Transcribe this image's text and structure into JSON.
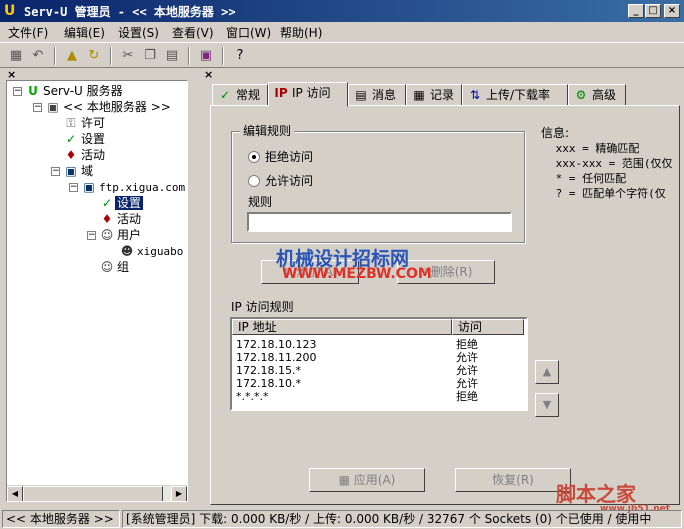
{
  "window": {
    "title": "Serv-U 管理员 - << 本地服务器 >>",
    "app_icon": "serv-u-icon",
    "controls": {
      "minimize": "_",
      "maximize": "□",
      "close": "×"
    }
  },
  "menu": {
    "file": "文件(F)",
    "edit": "编辑(E)",
    "settings": "设置(S)",
    "view": "查看(V)",
    "window": "窗口(W)",
    "help": "帮助(H)"
  },
  "toolbar": {
    "icons": [
      "save-icon",
      "undo-icon",
      "folder-up-icon",
      "refresh-icon",
      "cut-icon",
      "copy-icon",
      "paste-icon",
      "book-icon",
      "help-icon"
    ]
  },
  "tree": {
    "root": "Serv-U 服务器",
    "local_server": "<< 本地服务器 >>",
    "license": "许可",
    "settings": "设置",
    "activity": "活动",
    "domains": "域",
    "domain": "ftp.xigua.com",
    "domain_settings": "设置",
    "domain_activity": "活动",
    "users": "用户",
    "user_xiguabo": "xiguabo",
    "groups": "组"
  },
  "tabs": {
    "general": "常规",
    "ip_access": "IP 访问",
    "messages": "消息",
    "logging": "记录",
    "ul_dl_ratio": "上传/下载率",
    "advanced": "高级",
    "active": "ip_access"
  },
  "edit_rule": {
    "legend": "编辑规则",
    "deny": "拒绝访问",
    "allow": "允许访问",
    "selected": "deny",
    "rule_label": "规则",
    "rule_value": ""
  },
  "info": {
    "title": "信息:",
    "lines": [
      " xxx = 精确匹配",
      " xxx-xxx = 范围(仅仅",
      " * = 任何匹配",
      " ? = 匹配单个字符(仅"
    ]
  },
  "buttons": {
    "add": "添加(A)",
    "delete": "删除(R)",
    "apply": "应用(A)",
    "restore": "恢复(R)"
  },
  "ip_rules": {
    "title": "IP 访问规则",
    "columns": [
      "IP 地址",
      "访问"
    ],
    "rows": [
      [
        "172.18.10.123",
        "拒绝"
      ],
      [
        "172.18.11.200",
        "允许"
      ],
      [
        "172.18.15.*",
        "允许"
      ],
      [
        "172.18.10.*",
        "允许"
      ],
      [
        "*.*.*.*",
        "拒绝"
      ]
    ]
  },
  "status": {
    "server": "<< 本地服务器 >>",
    "stats": "[系统管理员] 下载: 0.000 KB/秒 / 上传: 0.000 KB/秒 / 32767 个 Sockets (0) 个已使用 / 使用中"
  },
  "watermarks": {
    "top": "机械设计招标网",
    "url": "WWW.MEZBW.COM",
    "bottom_right": "脚本之家",
    "bottom_right_url": "www.jb51.net"
  }
}
